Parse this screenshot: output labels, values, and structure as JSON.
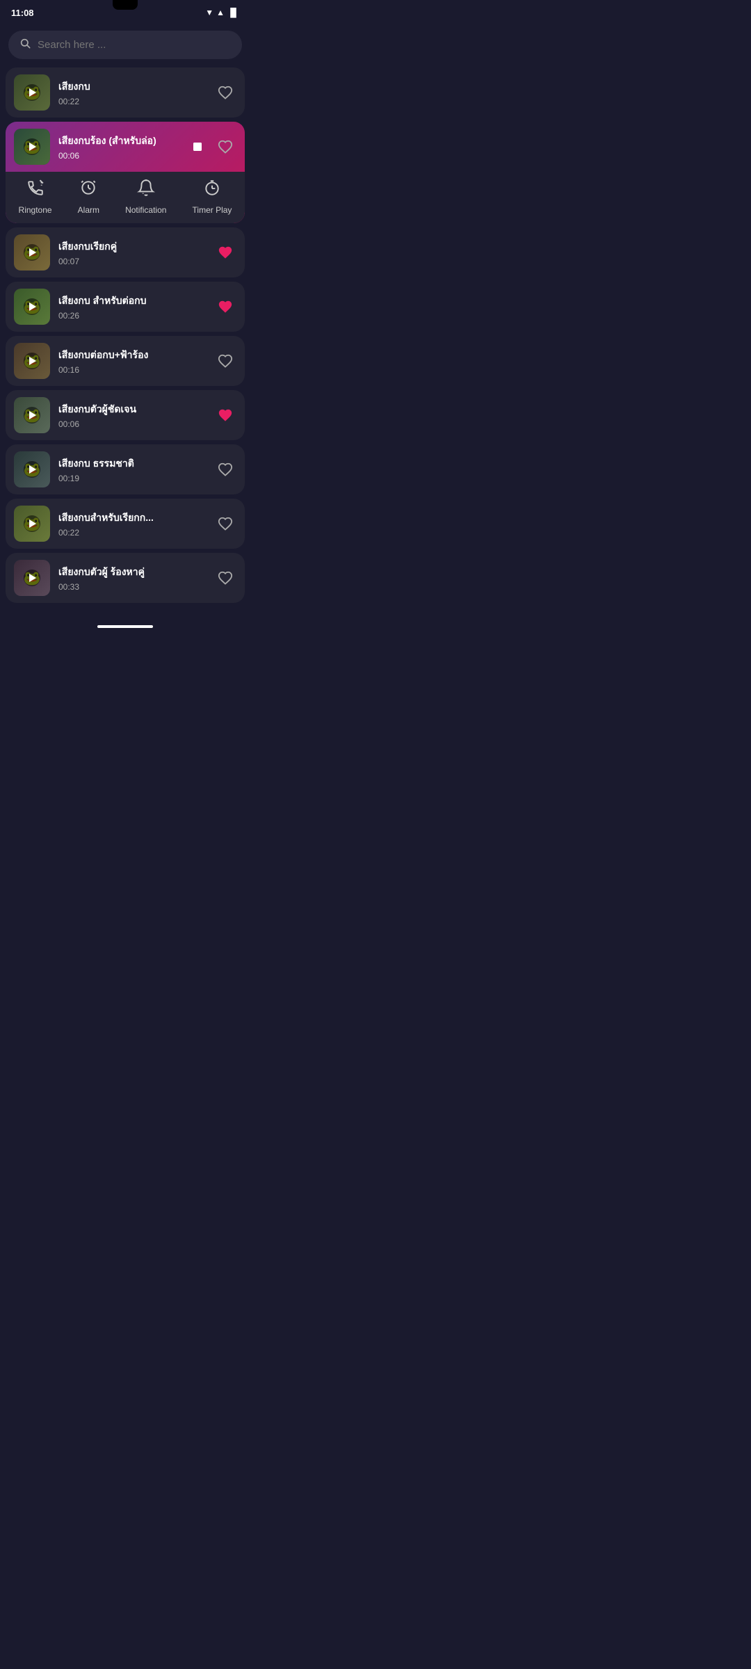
{
  "statusBar": {
    "time": "11:08",
    "wifi": "▼",
    "signal": "▲",
    "battery": "🔋"
  },
  "search": {
    "placeholder": "Search here ..."
  },
  "sounds": [
    {
      "id": 1,
      "title": "เสียงกบ",
      "duration": "00:22",
      "liked": false,
      "active": false,
      "thumbnail_class": "thumbnail-frog"
    },
    {
      "id": 2,
      "title": "เสียงกบร้อง (สำหรับล่อ)",
      "duration": "00:06",
      "liked": false,
      "active": true,
      "thumbnail_class": "thumbnail-frog2"
    },
    {
      "id": 3,
      "title": "เสียงกบเรียกคู่",
      "duration": "00:07",
      "liked": true,
      "active": false,
      "thumbnail_class": "thumbnail-frog3"
    },
    {
      "id": 4,
      "title": "เสียงกบ สำหรับต่อกบ",
      "duration": "00:26",
      "liked": true,
      "active": false,
      "thumbnail_class": "thumbnail-frog4"
    },
    {
      "id": 5,
      "title": "เสียงกบต่อกบ+ฟ้าร้อง",
      "duration": "00:16",
      "liked": false,
      "active": false,
      "thumbnail_class": "thumbnail-frog5"
    },
    {
      "id": 6,
      "title": "เสียงกบตัวผู้ชัดเจน",
      "duration": "00:06",
      "liked": true,
      "active": false,
      "thumbnail_class": "thumbnail-frog6"
    },
    {
      "id": 7,
      "title": "เสียงกบ ธรรมชาติ",
      "duration": "00:19",
      "liked": false,
      "active": false,
      "thumbnail_class": "thumbnail-frog7"
    },
    {
      "id": 8,
      "title": "เสียงกบสำหรับเรียกก...",
      "duration": "00:22",
      "liked": false,
      "active": false,
      "thumbnail_class": "thumbnail-frog8"
    },
    {
      "id": 9,
      "title": "เสียงกบตัวผู้ ร้องหาคู่",
      "duration": "00:33",
      "liked": false,
      "active": false,
      "thumbnail_class": "thumbnail-frog9"
    }
  ],
  "actionBar": {
    "items": [
      {
        "label": "Ringtone",
        "icon": "📳"
      },
      {
        "label": "Alarm",
        "icon": "⏰"
      },
      {
        "label": "Notification",
        "icon": "🔔"
      },
      {
        "label": "Timer Play",
        "icon": "⏱"
      }
    ]
  }
}
